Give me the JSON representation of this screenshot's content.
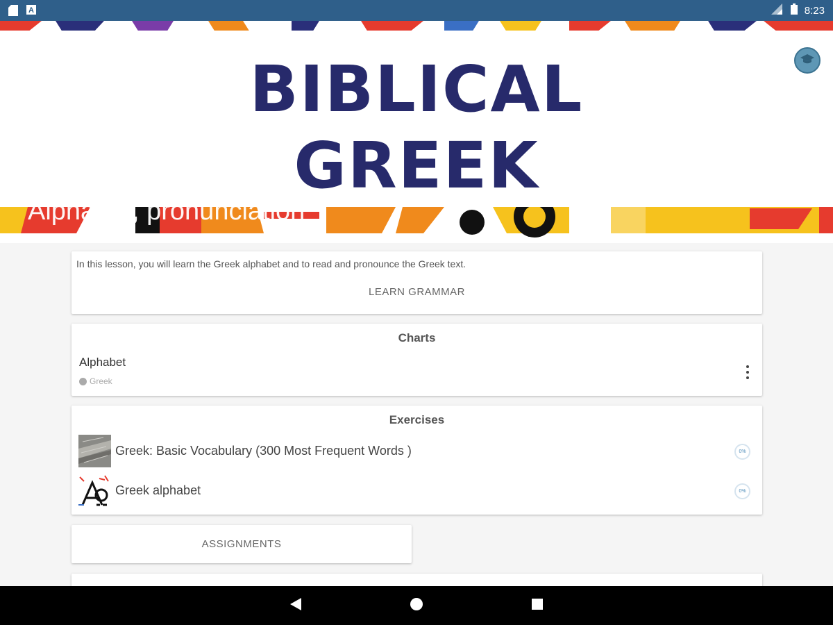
{
  "status_bar": {
    "time": "8:23"
  },
  "banner": {
    "title_line1": "BIBLICAL",
    "title_line2": "GREEK",
    "subtitle": "Alphabet, pronunciation"
  },
  "intro": {
    "text": "In this lesson, you will learn the Greek alphabet and to read and pronounce the Greek text.",
    "button_label": "LEARN GRAMMAR"
  },
  "charts": {
    "title": "Charts",
    "items": [
      {
        "title": "Alphabet",
        "subtitle": "Greek"
      }
    ]
  },
  "exercises": {
    "title": "Exercises",
    "items": [
      {
        "label": "Greek: Basic Vocabulary (300 Most Frequent Words )",
        "progress": "0%"
      },
      {
        "label": "Greek alphabet",
        "progress": "0%"
      }
    ]
  },
  "assignments": {
    "label": "ASSIGNMENTS"
  },
  "colors": {
    "status_bar": "#2f5f8a",
    "title": "#272a6b",
    "progress": "#4a8ab8"
  }
}
